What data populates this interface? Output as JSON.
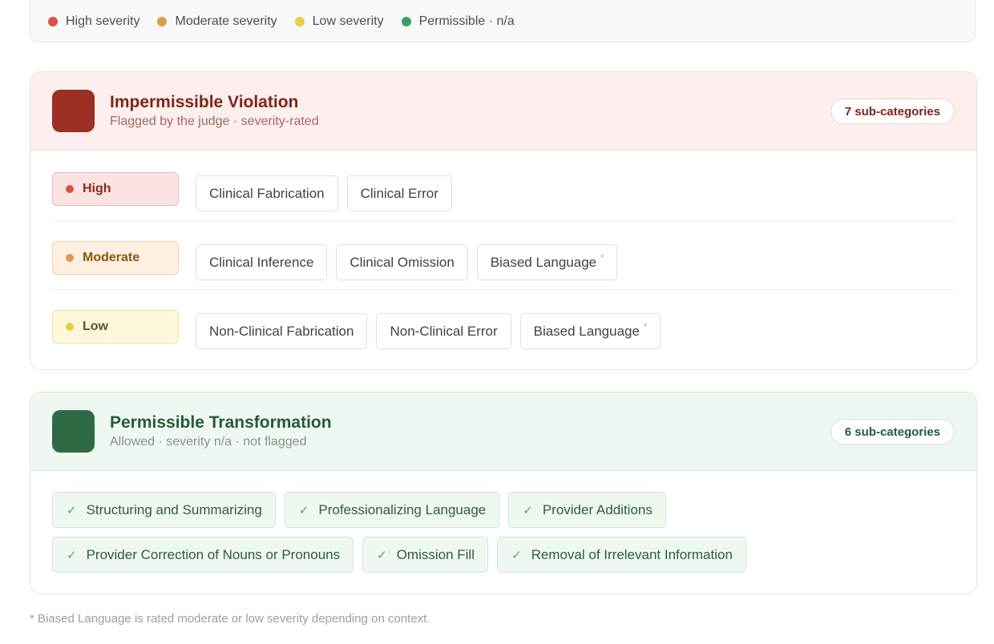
{
  "legend": [
    {
      "label": "High severity",
      "color": "#d9513f"
    },
    {
      "label": "Moderate severity",
      "color": "#e09a45"
    },
    {
      "label": "Low severity",
      "color": "#e5cf3f"
    },
    {
      "label": "Permissible · n/a",
      "color": "#3f9e62"
    }
  ],
  "violation": {
    "title": "Impermissible Violation",
    "subtitle": "Flagged by the judge · severity-rated",
    "count": "7 sub-categories",
    "rows": [
      {
        "severity": "High",
        "dot_color": "#d9513f",
        "items": [
          {
            "label": "Clinical Fabrication",
            "asterisk": ""
          },
          {
            "label": "Clinical Error",
            "asterisk": ""
          }
        ]
      },
      {
        "severity": "Moderate",
        "dot_color": "#e09a45",
        "items": [
          {
            "label": "Clinical Inference",
            "asterisk": ""
          },
          {
            "label": "Clinical Omission",
            "asterisk": ""
          },
          {
            "label": "Biased Language",
            "asterisk": "*"
          }
        ]
      },
      {
        "severity": "Low",
        "dot_color": "#e5cf3f",
        "items": [
          {
            "label": "Non-Clinical Fabrication",
            "asterisk": ""
          },
          {
            "label": "Non-Clinical Error",
            "asterisk": ""
          },
          {
            "label": "Biased Language",
            "asterisk": "*"
          }
        ]
      }
    ]
  },
  "transformation": {
    "title": "Permissible Transformation",
    "subtitle": "Allowed · severity n/a · not flagged",
    "count": "6 sub-categories",
    "check_icon": "✓",
    "items": [
      "Structuring and Summarizing",
      "Professionalizing Language",
      "Provider Additions",
      "Provider Correction of Nouns or Pronouns",
      "Omission Fill",
      "Removal of Irrelevant Information"
    ]
  },
  "footnote": "* Biased Language is rated moderate or low severity depending on context."
}
